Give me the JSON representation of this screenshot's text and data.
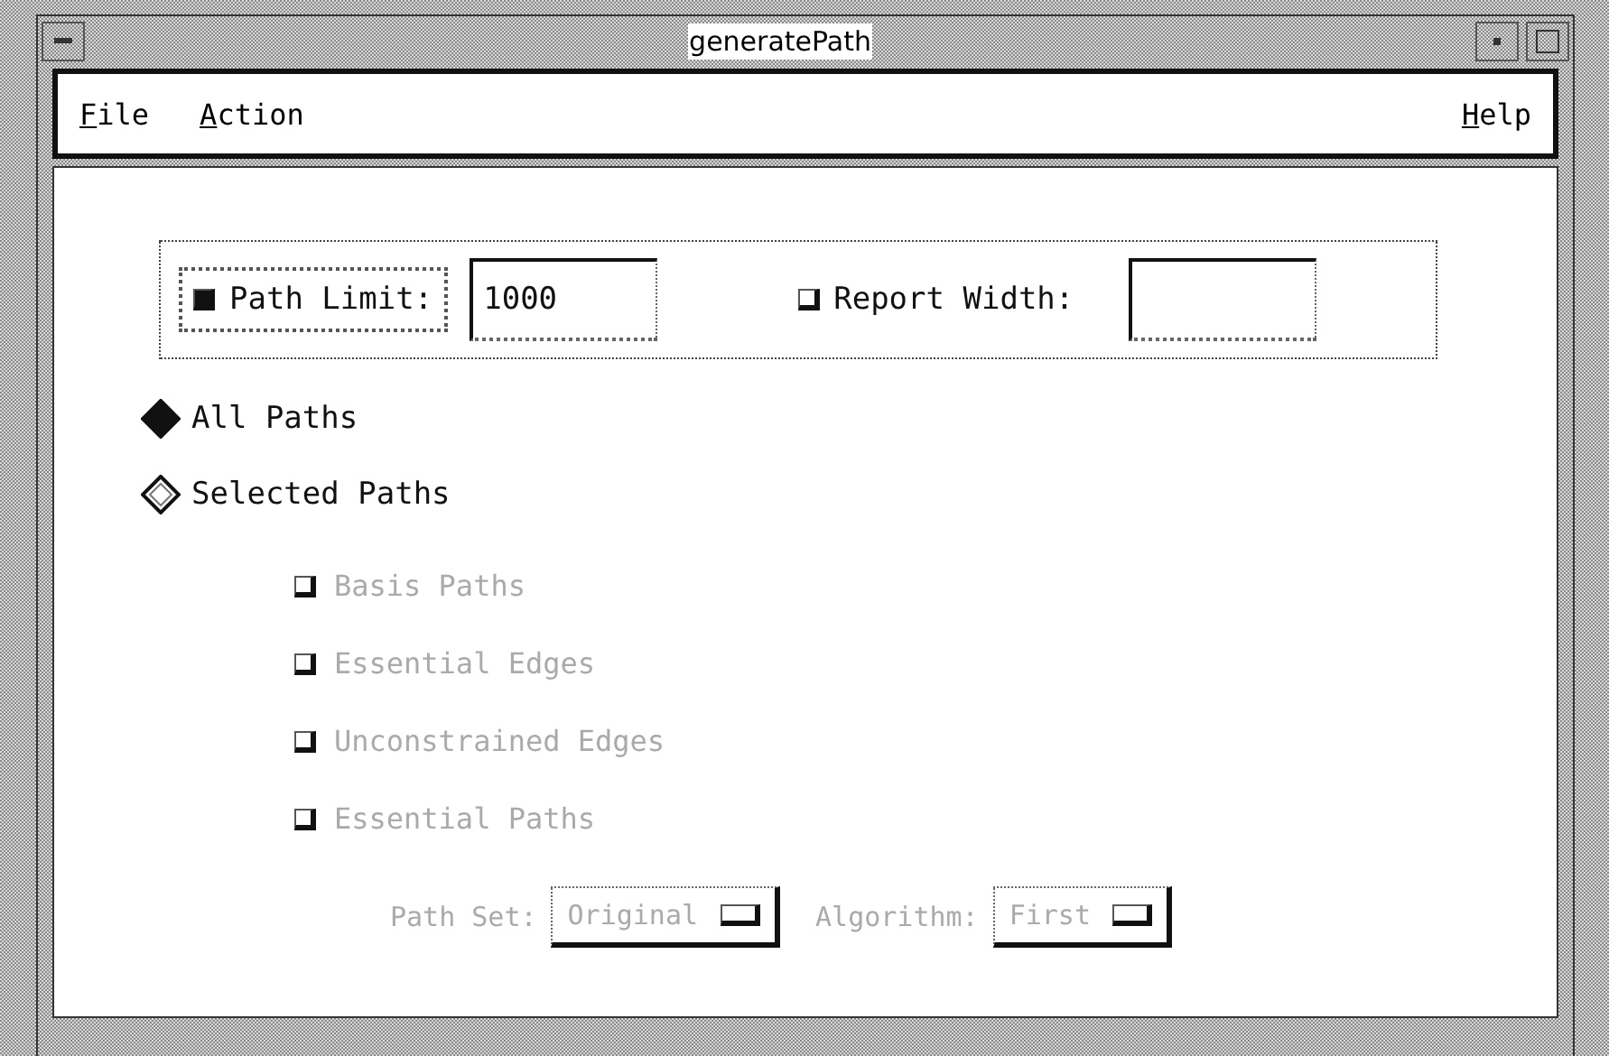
{
  "window": {
    "title": "generatePath"
  },
  "menu": {
    "left": [
      {
        "label": "File"
      },
      {
        "label": "Action"
      }
    ],
    "right": [
      {
        "label": "Help"
      }
    ]
  },
  "limits": [
    {
      "label": "Path Limit:",
      "checked": true,
      "focused": true,
      "value": "1000"
    },
    {
      "label": "Report Width:",
      "checked": false,
      "focused": false
    }
  ],
  "modes": [
    {
      "label": "All Paths",
      "selected": true
    },
    {
      "label": "Selected Paths",
      "selected": false
    }
  ],
  "options": [
    {
      "label": "Basis Paths",
      "checked": false,
      "disabled": true
    },
    {
      "label": "Essential Edges",
      "checked": false,
      "disabled": true
    },
    {
      "label": "Unconstrained Edges",
      "checked": false,
      "disabled": true
    },
    {
      "label": "Essential Paths",
      "checked": false,
      "disabled": true
    }
  ],
  "selectors": [
    {
      "label": "Path Set:",
      "value": "Original",
      "disabled": true
    },
    {
      "label": "Algorithm:",
      "value": "First",
      "disabled": true
    }
  ]
}
